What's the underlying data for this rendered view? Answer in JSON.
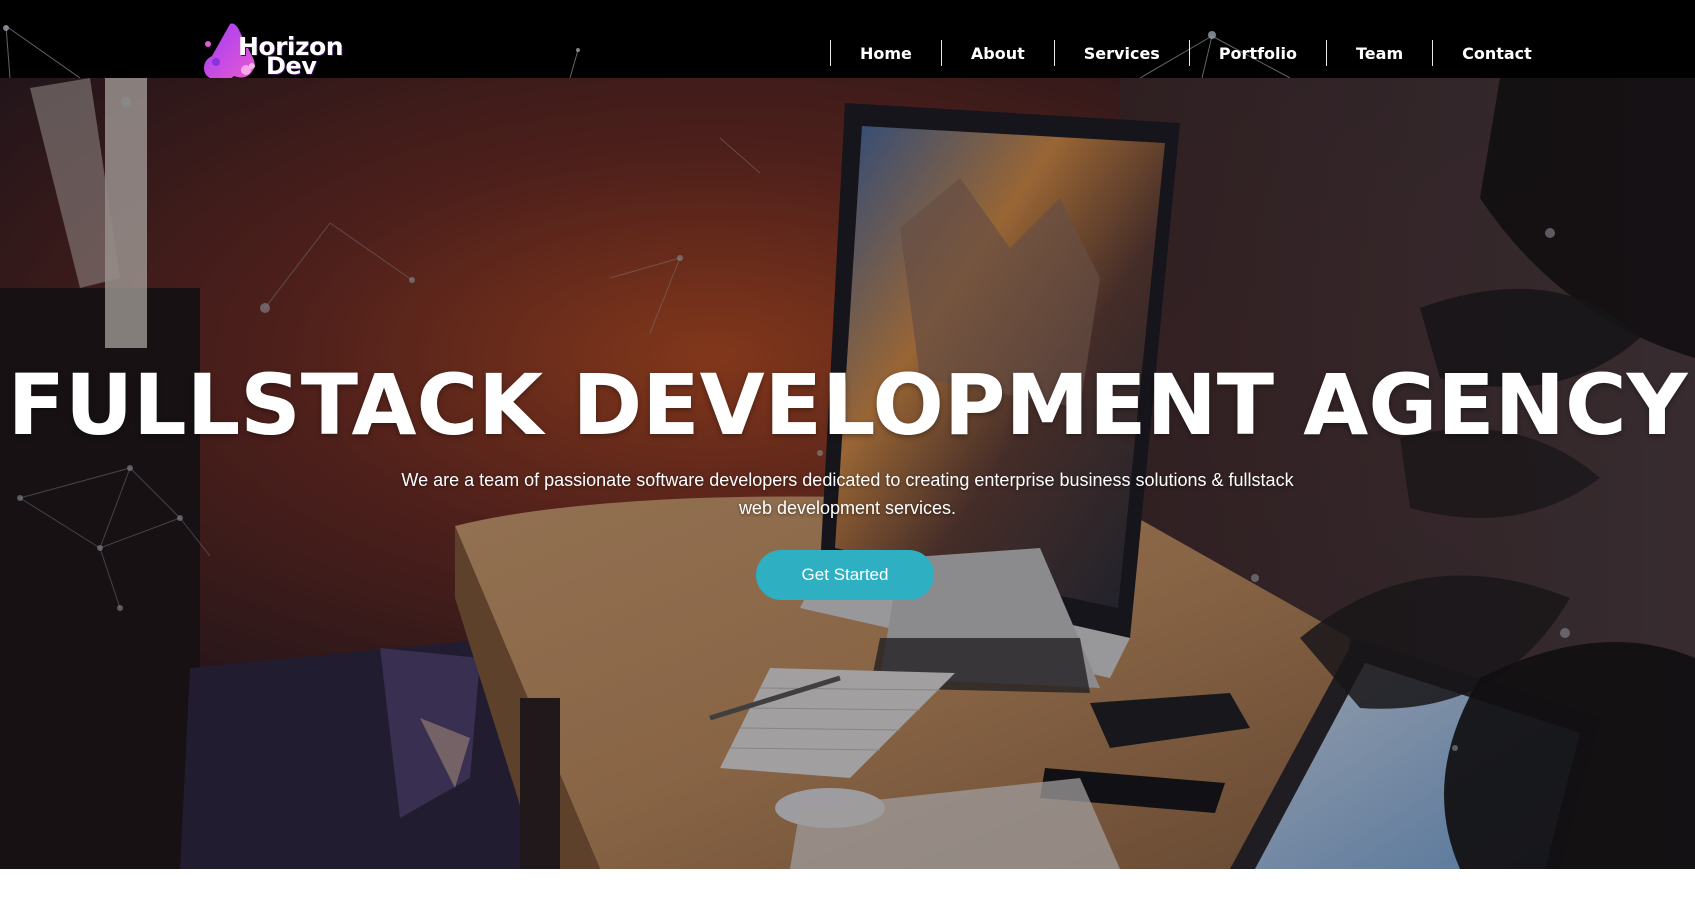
{
  "brand": {
    "line1": "Horizon",
    "line2": "Dev",
    "logo_icon": "mountain-blob-logo",
    "colors": {
      "primary": "#8a3df0",
      "secondary": "#e04fc7"
    }
  },
  "nav": {
    "items": [
      {
        "label": "Home"
      },
      {
        "label": "About"
      },
      {
        "label": "Services"
      },
      {
        "label": "Portfolio"
      },
      {
        "label": "Team"
      },
      {
        "label": "Contact"
      }
    ]
  },
  "hero": {
    "title": "FULLSTACK DEVELOPMENT AGENCY",
    "description": "We are a team of passionate software developers dedicated to creating enterprise business solutions & fullstack web development services.",
    "cta_label": "Get Started",
    "accent": "#2eafc2",
    "background": "desk-with-imac-photo"
  }
}
